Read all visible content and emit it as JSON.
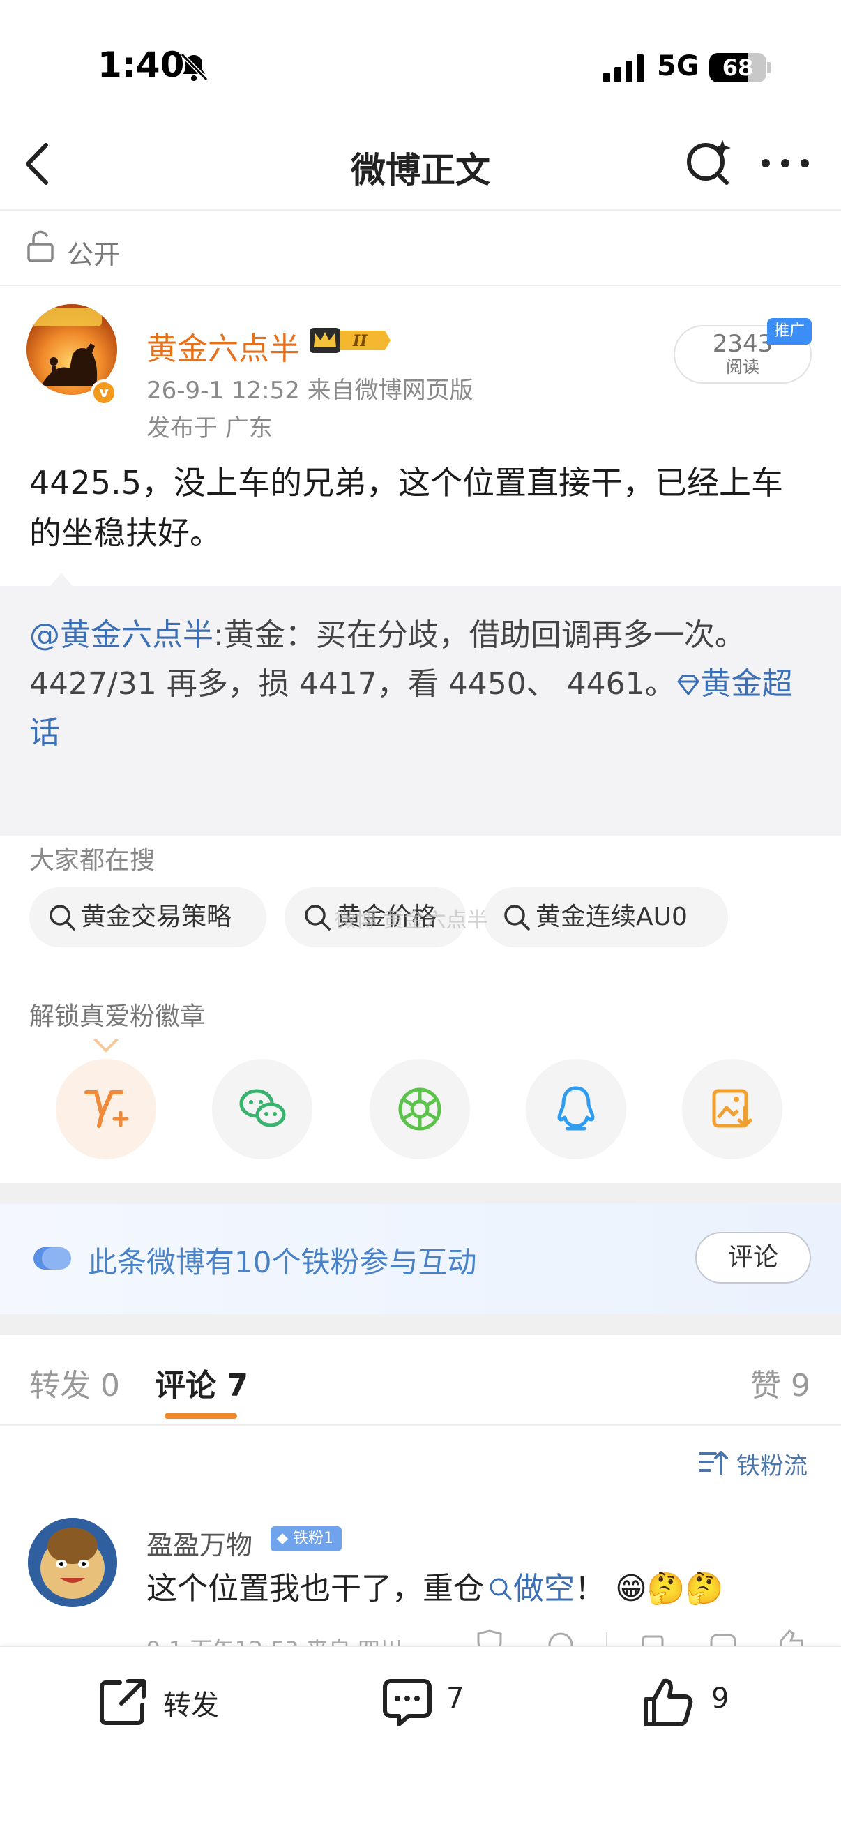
{
  "status": {
    "time": "1:40",
    "network": "5G",
    "battery": "68",
    "battery_level": 0.68
  },
  "nav": {
    "title": "微博正文"
  },
  "visibility": "公开",
  "post": {
    "author": "黄金六点半",
    "time_source": "26-9-1 12:52  来自微博网页版",
    "location": "发布于 广东",
    "reads": "2343",
    "reads_label": "阅读",
    "promo": "推广",
    "avatar_badge": "v",
    "text": "4425.5，没上车的兄弟，这个位置直接干，已经上车的坐稳扶好。"
  },
  "repost": {
    "mention": "@黄金六点半",
    "text": ":黄金：买在分歧，借助回调再多一次。4427/31 再多，损 4417，看 4450、 4461。",
    "topic": "黄金超话"
  },
  "hot_search": {
    "title": "大家都在搜",
    "items": [
      "黄金交易策略",
      "黄金价格",
      "黄金连续AU0"
    ],
    "watermark": "微博 黄金六点半"
  },
  "badge_section": {
    "title": "解锁真爱粉徽章"
  },
  "share_icons": [
    "vplus-icon",
    "wechat-icon",
    "moments-icon",
    "qq-icon",
    "save-image-icon"
  ],
  "fans_banner": {
    "text": "此条微博有10个铁粉参与互动",
    "button": "评论"
  },
  "tabs": {
    "repost": "转发 0",
    "comment": "评论 7",
    "like": "赞 9"
  },
  "sort": {
    "label": "铁粉流"
  },
  "comment": {
    "user": "盈盈万物",
    "fan_badge": "铁粉1",
    "text": "这个位置我也干了，重仓",
    "link": "做空",
    "tail": "！",
    "emojis": "😁🤔🤔",
    "meta": "9-1 下午12:53  来自 四川"
  },
  "bottom": {
    "repost": "转发",
    "comment_count": "7",
    "like_count": "9"
  },
  "colors": {
    "accent": "#ee8a2a",
    "link": "#3b6fb6",
    "name_orange": "#e8701a"
  }
}
